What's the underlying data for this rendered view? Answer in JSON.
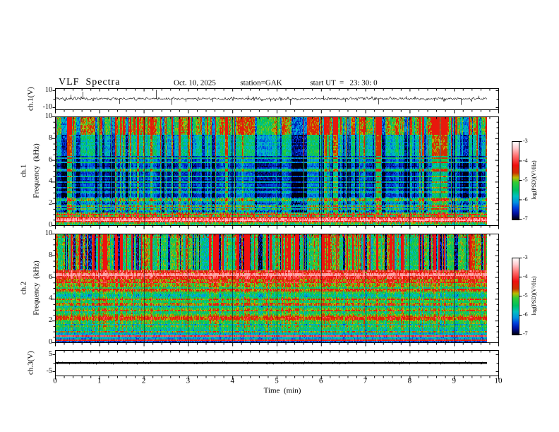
{
  "header": {
    "title": "VLF  Spectra",
    "date": "Oct. 10, 2025",
    "station": "station=GAK",
    "start_ut": "start UT  =   23: 30: 0"
  },
  "axes": {
    "x": {
      "label": "Time  (min)",
      "ticks": [
        "0",
        "1",
        "2",
        "3",
        "4",
        "5",
        "6",
        "7",
        "8",
        "9",
        "10"
      ],
      "range_min": [
        0,
        10
      ],
      "minor_step_min": 0.2
    },
    "panels": [
      {
        "id": "wf",
        "channel": "ch.1(V)",
        "y_ticks": [
          "10",
          "-10"
        ],
        "y_range": [
          -12.5,
          12.5
        ]
      },
      {
        "id": "spec1",
        "channel": "ch.1",
        "y_label": "Frequency  (kHz)",
        "y_ticks": [
          "0",
          "2",
          "4",
          "6",
          "8",
          "10"
        ],
        "y_range_khz": [
          0,
          10
        ]
      },
      {
        "id": "spec2",
        "channel": "ch.2",
        "y_label": "Frequency  (kHz)",
        "y_ticks": [
          "0",
          "2",
          "4",
          "6",
          "8",
          "10"
        ],
        "y_range_khz": [
          0,
          10
        ]
      },
      {
        "id": "ch3",
        "channel": "ch.3(V)",
        "y_ticks": [
          "5",
          "-5"
        ],
        "y_range": [
          -7.5,
          7.5
        ]
      }
    ]
  },
  "colorbars": [
    {
      "label": "log(PSD)(V²/Hz)",
      "ticks": [
        "-3",
        "-4",
        "-5",
        "-6",
        "-7"
      ],
      "range": [
        -3,
        -7
      ]
    },
    {
      "label": "log(PSD)(V²/Hz)",
      "ticks": [
        "-3",
        "-4",
        "-5",
        "-6",
        "-7"
      ],
      "range": [
        -3,
        -7
      ]
    }
  ],
  "colormap": [
    {
      "pos": 0.0,
      "color": "#ffffff"
    },
    {
      "pos": 0.08,
      "color": "#ffccd0"
    },
    {
      "pos": 0.18,
      "color": "#ff7070"
    },
    {
      "pos": 0.3,
      "color": "#f01010"
    },
    {
      "pos": 0.4,
      "color": "#cc3300"
    },
    {
      "pos": 0.46,
      "color": "#bbbb00"
    },
    {
      "pos": 0.52,
      "color": "#33cc33"
    },
    {
      "pos": 0.62,
      "color": "#00c060"
    },
    {
      "pos": 0.7,
      "color": "#00c0c0"
    },
    {
      "pos": 0.78,
      "color": "#0090e0"
    },
    {
      "pos": 0.85,
      "color": "#0040dd"
    },
    {
      "pos": 0.92,
      "color": "#0010a0"
    },
    {
      "pos": 1.0,
      "color": "#000010"
    }
  ],
  "chart_data": [
    {
      "id": "wf",
      "type": "line",
      "title": "ch.1 broadband waveform",
      "units": "V",
      "x_range_min": [
        0,
        9.74
      ],
      "y_range_V": [
        -12.5,
        12.5
      ],
      "baseline_V": 0,
      "noise_std_V": 0.8,
      "seed": 12345,
      "spikes": [
        {
          "t_min": 0.35,
          "amp_V": 4
        },
        {
          "t_min": 0.62,
          "amp_V": 7
        },
        {
          "t_min": 1.45,
          "amp_V": -5
        },
        {
          "t_min": 2.28,
          "amp_V": 9
        },
        {
          "t_min": 2.62,
          "amp_V": -6
        },
        {
          "t_min": 2.95,
          "amp_V": -3
        },
        {
          "t_min": 3.55,
          "amp_V": -3
        },
        {
          "t_min": 4.35,
          "amp_V": 3
        },
        {
          "t_min": 4.85,
          "amp_V": -2.5
        },
        {
          "t_min": 5.3,
          "amp_V": -6
        },
        {
          "t_min": 6.05,
          "amp_V": 3
        },
        {
          "t_min": 6.55,
          "amp_V": -3
        },
        {
          "t_min": 7.3,
          "amp_V": -5.5
        },
        {
          "t_min": 7.92,
          "amp_V": 2.5
        },
        {
          "t_min": 8.55,
          "amp_V": -2
        },
        {
          "t_min": 9.15,
          "amp_V": -6
        },
        {
          "t_min": 9.55,
          "amp_V": 3
        }
      ]
    },
    {
      "id": "spec1",
      "type": "heatmap",
      "title": "ch.1 VLF spectrogram",
      "x_range_min": [
        0,
        9.74
      ],
      "f_range_khz": [
        0,
        10
      ],
      "z": "log10 PSD (V²/Hz)",
      "z_range": [
        -7,
        -3
      ],
      "seed": 777,
      "streaks": {
        "bright_prob": 0.085,
        "dark_prob": 0.075,
        "medium_prob": 0.3
      },
      "bands": [
        {
          "f_khz": [
            8.3,
            10
          ],
          "base": 0.5,
          "noise": 0.1,
          "streak_k": 0.9,
          "cap": 0.68,
          "row_var": 0.03
        },
        {
          "f_khz": [
            6.3,
            8.3
          ],
          "base": 0.3,
          "noise": 0.08,
          "streak_k": 0.65,
          "cap": 0.62,
          "row_var": 0.04
        },
        {
          "f_khz": [
            2.6,
            6.3
          ],
          "base": 0.13,
          "noise": 0.06,
          "streak_k": 0.5,
          "cap": 1.0,
          "row_var": 0.05
        },
        {
          "f_khz": [
            1.15,
            2.6
          ],
          "base": 0.24,
          "noise": 0.1,
          "streak_k": 0.45,
          "cap": 1.0,
          "row_var": 0.06
        },
        {
          "f_khz": [
            0.78,
            1.15
          ],
          "base": 0.52,
          "noise": 0.16,
          "streak_k": 0.2,
          "cap": 0.75,
          "row_var": 0.05
        },
        {
          "f_khz": [
            0.3,
            0.78
          ],
          "base": 0.74,
          "noise": 0.13,
          "streak_k": 0.05,
          "cap": 0.9,
          "row_var": 0.06
        },
        {
          "f_khz": [
            0,
            0.3
          ],
          "base": 0.42,
          "noise": 0.14,
          "streak_k": 0.1,
          "cap": 0.8,
          "row_var": 0.05
        }
      ],
      "lines_khz": [
        {
          "f": 6.2,
          "add": 0.27
        },
        {
          "f": 5.75,
          "add": 0.2
        },
        {
          "f": 5.05,
          "add": 0.28
        },
        {
          "f": 4.45,
          "add": 0.22
        },
        {
          "f": 3.95,
          "add": 0.2
        },
        {
          "f": 3.45,
          "add": 0.22
        },
        {
          "f": 3.05,
          "add": 0.18
        },
        {
          "f": 2.35,
          "add": 0.2
        },
        {
          "f": 1.75,
          "add": 0.22
        },
        {
          "f": 1.45,
          "add": 0.18
        },
        {
          "f": 0.95,
          "add": 0.18
        },
        {
          "f": 0.52,
          "add": 0.12
        }
      ]
    },
    {
      "id": "spec2",
      "type": "heatmap",
      "title": "ch.2 VLF spectrogram",
      "x_range_min": [
        0,
        9.74
      ],
      "f_range_khz": [
        0,
        10
      ],
      "z": "log10 PSD (V²/Hz)",
      "z_range": [
        -7,
        -3
      ],
      "seed": 4242,
      "streaks": {
        "bright_prob": 0.1,
        "dark_prob": 0.1,
        "medium_prob": 0.3
      },
      "bands": [
        {
          "f_khz": [
            6.6,
            10
          ],
          "base": 0.4,
          "noise": 0.1,
          "streak_k": 1.0,
          "cap": 0.7,
          "row_var": 0.05,
          "fleck_top": 0.12
        },
        {
          "f_khz": [
            5.9,
            6.6
          ],
          "base": 0.7,
          "noise": 0.12,
          "streak_k": 0.15,
          "cap": 0.88,
          "row_var": 0.06
        },
        {
          "f_khz": [
            5.2,
            5.9
          ],
          "base": 0.55,
          "noise": 0.1,
          "streak_k": 0.2,
          "cap": 0.8,
          "row_var": 0.06
        },
        {
          "f_khz": [
            4.4,
            5.2
          ],
          "base": 0.46,
          "noise": 0.1,
          "streak_k": 0.2,
          "cap": 0.8,
          "row_var": 0.09
        },
        {
          "f_khz": [
            2.6,
            4.4
          ],
          "base": 0.36,
          "noise": 0.09,
          "streak_k": 0.25,
          "cap": 0.8,
          "row_var": 0.11
        },
        {
          "f_khz": [
            1.9,
            2.6
          ],
          "base": 0.5,
          "noise": 0.1,
          "streak_k": 0.2,
          "cap": 0.8,
          "row_var": 0.07
        },
        {
          "f_khz": [
            0.85,
            1.9
          ],
          "base": 0.37,
          "noise": 0.1,
          "streak_k": 0.22,
          "cap": 0.8,
          "row_var": 0.09
        },
        {
          "f_khz": [
            0.3,
            0.85
          ],
          "base": 0.22,
          "noise": 0.09,
          "streak_k": 0.1,
          "cap": 0.8,
          "row_var": 0.06
        },
        {
          "f_khz": [
            0,
            0.3
          ],
          "base": 0.13,
          "noise": 0.08,
          "streak_k": 0.06,
          "cap": 0.8,
          "row_var": 0.04
        }
      ],
      "lines_khz": [
        {
          "f": 6.25,
          "add": 0.15
        },
        {
          "f": 5.5,
          "add": 0.1
        },
        {
          "f": 4.8,
          "add": 0.12
        },
        {
          "f": 4.0,
          "add": 0.14
        },
        {
          "f": 3.5,
          "add": 0.12
        },
        {
          "f": 3.0,
          "add": 0.12
        },
        {
          "f": 2.2,
          "add": 0.12
        },
        {
          "f": 1.5,
          "add": 0.12
        },
        {
          "f": 1.0,
          "add": 0.12
        },
        {
          "f": 0.55,
          "add": 0.5
        },
        {
          "f": 0.18,
          "add": 0.55
        }
      ]
    },
    {
      "id": "ch3",
      "type": "line",
      "title": "ch.3 waveform (flat)",
      "units": "V",
      "x_range_min": [
        0,
        9.74
      ],
      "y_range_V": [
        -7.5,
        7.5
      ],
      "value_V": 0,
      "thickness_V": 1.2,
      "seed": 99
    }
  ]
}
